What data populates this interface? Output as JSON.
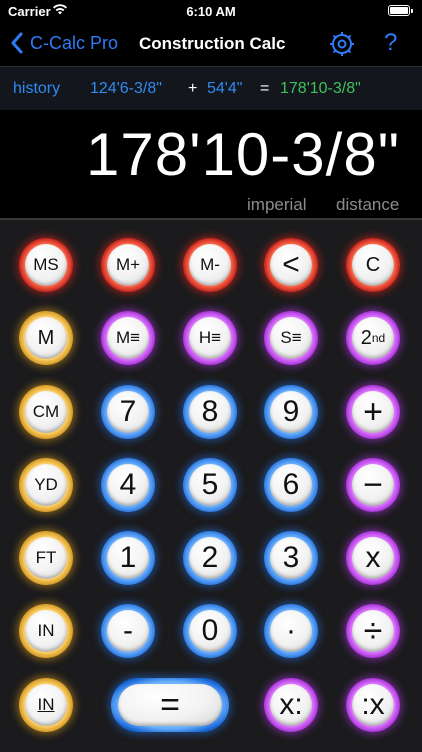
{
  "status_bar": {
    "carrier": "Carrier",
    "time": "6:10 AM"
  },
  "nav": {
    "back_label": "C-Calc Pro",
    "title": "Construction Calc",
    "help_label": "?"
  },
  "history": {
    "label": "history",
    "operand1": "124'6-3/8\"",
    "operator": "+",
    "operand2": "54'4\"",
    "equals": "=",
    "result": "178'10-3/8\""
  },
  "display": {
    "value": "178'10-3/8\"",
    "unit_system": "imperial",
    "mode": "distance"
  },
  "colors": {
    "memory_ring": "#e02a1e",
    "unit_ring": "#f0aa1e",
    "function_ring": "#be3cfa",
    "digit_ring": "#2878f0",
    "history_link": "#2f8bf0",
    "history_result": "#3dc25a",
    "nav_accent": "#2f7cf6"
  },
  "keys": {
    "ms": "MS",
    "m_plus": "M+",
    "m_minus": "M-",
    "backspace": "<",
    "clear": "C",
    "m": "M",
    "m_list": "M≡",
    "h_list": "H≡",
    "s_list": "S≡",
    "second_base": "2",
    "second_sup": "nd",
    "cm": "CM",
    "seven": "7",
    "eight": "8",
    "nine": "9",
    "plus": "+",
    "yd": "YD",
    "four": "4",
    "five": "5",
    "six": "6",
    "minus": "−",
    "ft": "FT",
    "one": "1",
    "two": "2",
    "three": "3",
    "multiply": "x",
    "in": "IN",
    "dash": "-",
    "zero": "0",
    "dot": "·",
    "divide": "÷",
    "in_fraction": "IN",
    "equals": "=",
    "x_colon": "x:",
    "colon_x": ":x"
  }
}
